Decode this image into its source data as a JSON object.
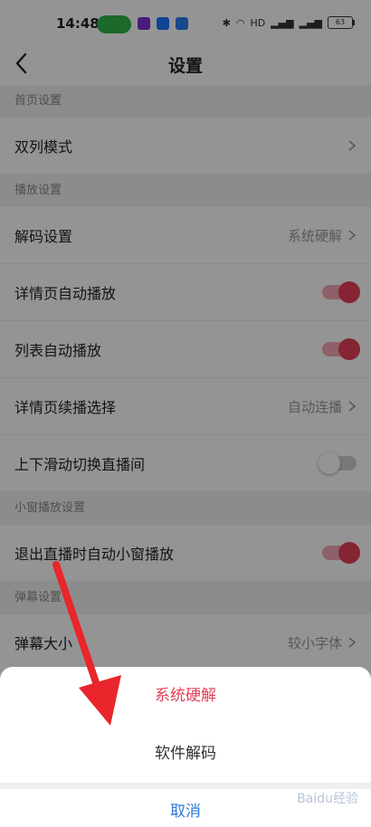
{
  "statusbar": {
    "time": "14:48",
    "battery": "63",
    "network": "HD"
  },
  "header": {
    "title": "设置"
  },
  "sections": {
    "home": "首页设置",
    "playback": "播放设置",
    "mini": "小窗播放设置",
    "danmaku": "弹幕设置"
  },
  "rows": {
    "dual_column": {
      "label": "双列模式"
    },
    "decode": {
      "label": "解码设置",
      "value": "系统硬解"
    },
    "detail_autoplay": {
      "label": "详情页自动播放",
      "on": true
    },
    "list_autoplay": {
      "label": "列表自动播放",
      "on": true
    },
    "detail_continue": {
      "label": "详情页续播选择",
      "value": "自动连播"
    },
    "swipe_switch": {
      "label": "上下滑动切换直播间",
      "on": false
    },
    "exit_mini": {
      "label": "退出直播时自动小窗播放",
      "on": true
    },
    "danmaku_size": {
      "label": "弹幕大小",
      "value": "较小字体"
    }
  },
  "sheet": {
    "option_hardware": "系统硬解",
    "option_software": "软件解码",
    "cancel": "取消"
  },
  "colors": {
    "accent": "#e63e56",
    "cancel": "#2f7bd9",
    "arrow": "#e8262b"
  },
  "watermark": "Baidu经验"
}
